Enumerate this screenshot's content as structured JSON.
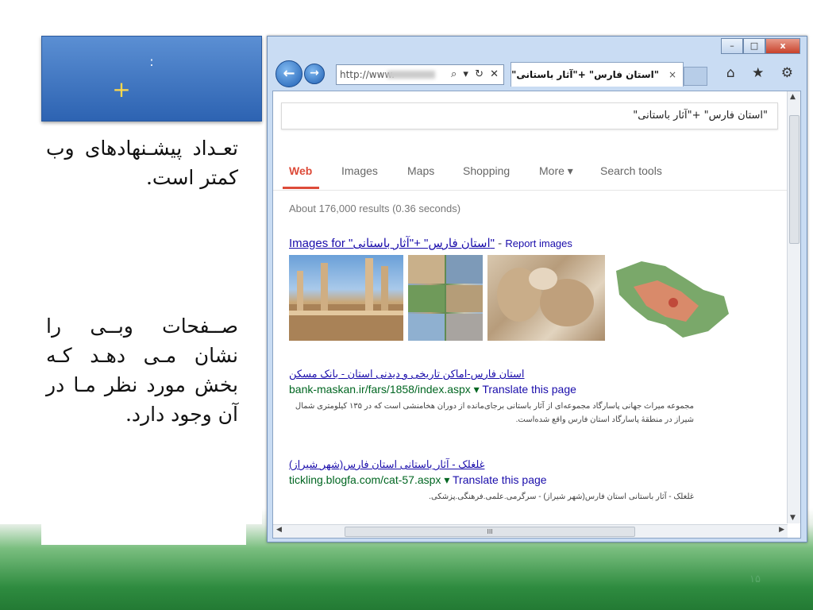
{
  "slide": {
    "title_colon": ":",
    "title_plus": "+",
    "para1": "تعـداد پیشـنهادهای وب کمتر است.",
    "para2": "صــفحات وبــی را نشان مـی دهـد کـه بخش مورد نظر مـا در آن وجود دارد.",
    "page_number": "۱۵"
  },
  "browser": {
    "window_controls": {
      "minimize": "–",
      "maximize": "□",
      "close": "x"
    },
    "back_glyph": "←",
    "forward_glyph": "→",
    "address_text": "http://www.",
    "address_tools": "⌕ ▾ ↻ ✕",
    "tab_title": "\"استان فارس\" +\"آثار باستانی\"",
    "tab_close": "×",
    "toolbar_icons": "⌂ ★ ⚙"
  },
  "google": {
    "query": "\"استان فارس\" +\"آثار باستانی\"",
    "tabs": [
      "Web",
      "Images",
      "Maps",
      "Shopping",
      "More ▾",
      "Search tools"
    ],
    "result_stats": "About 176,000 results (0.36 seconds)",
    "images_head_link": "Images for \"استان فارس\" +\"آثار باستانی\"",
    "images_head_sep": " - ",
    "report_images": "Report images",
    "results": [
      {
        "title": "استان فارس-اماکن تاریخی و دیدنی استان - بانک مسکن",
        "url": "bank-maskan.ir/fars/1858/index.aspx",
        "translate": "Translate this page",
        "snippet": "مجموعه میراث جهانی پاسارگاد مجموعه‌ای از آثار باستانی برجای‌مانده از دوران هخامنشی است که در ۱۳۵ کیلومتری شمال شیراز در منطقهٔ پاسارگاد استان فارس واقع شده‌است."
      },
      {
        "title": "غلغلک - آثار باستانی استان فارس(شهر شیراز)",
        "url": "tickling.blogfa.com/cat-57.aspx",
        "translate": "Translate this page",
        "snippet": "غلغلک - آثار باستانی استان فارس(شهر شیراز) - سرگرمی.علمی.فرهنگی.پزشکی."
      }
    ]
  },
  "scrollbar": {
    "up": "▲",
    "down": "▼",
    "left": "◀",
    "right": "▶",
    "grip": "III"
  },
  "colors": {
    "accent_red": "#dd4b39",
    "link_blue": "#1a0dab",
    "url_green": "#006621",
    "title_blue": "#2d63b2",
    "plus_yellow": "#ffd84a"
  }
}
